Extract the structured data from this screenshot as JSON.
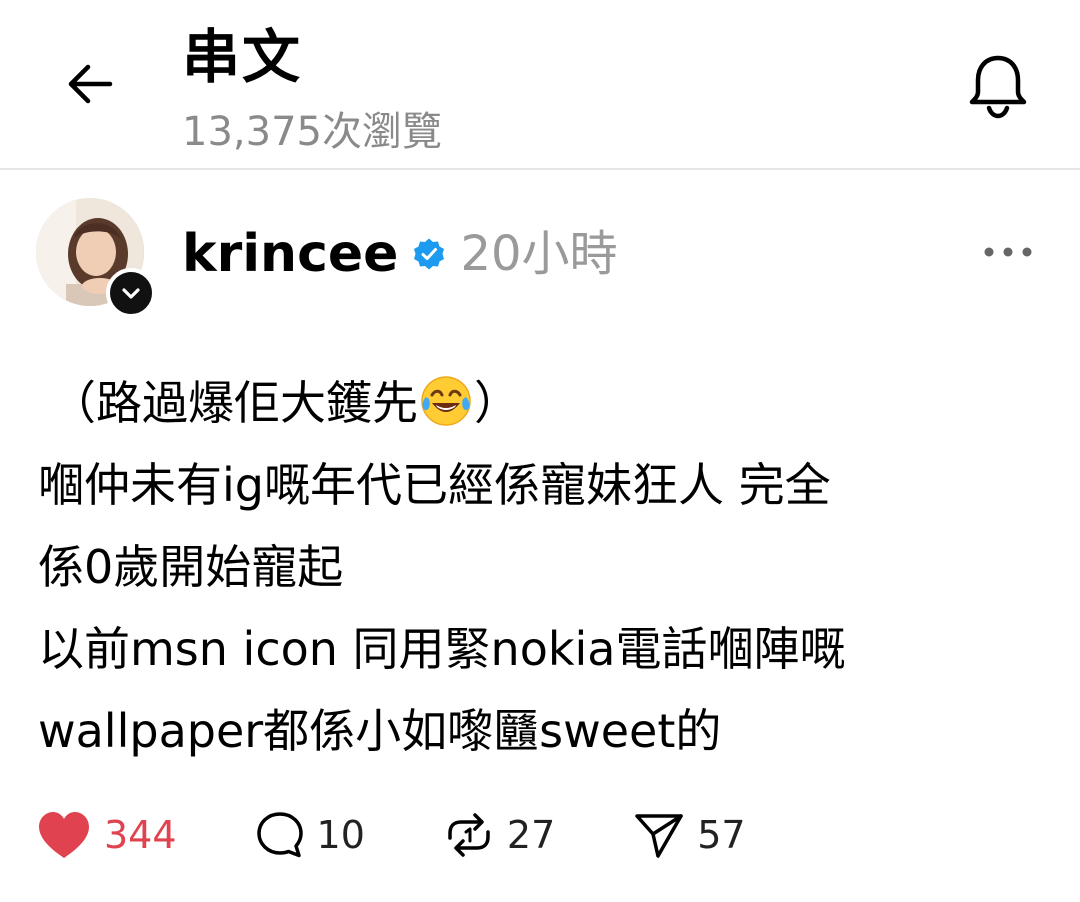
{
  "header": {
    "title": "串文",
    "views": "13,375次瀏覽"
  },
  "post": {
    "username": "krincee",
    "verified": true,
    "time": "20小時",
    "lines": [
      "（路過爆佢大鑊先",
      "嗰仲未有ig嘅年代已經係寵妹狂人 完全",
      "係0歲開始寵起",
      "以前msn icon 同用緊nokia電話嗰陣嘅",
      "wallpaper都係小如嚟㔶sweet的"
    ],
    "line1_close": "）",
    "emoji": "face-with-tears-of-joy",
    "likes": "344",
    "replies": "10",
    "reposts": "27",
    "shares": "57"
  },
  "colors": {
    "like": "#e0424f",
    "verified": "#1d9bf0",
    "muted": "#8a8a8a",
    "divider": "#e6e6e6"
  },
  "icons": {
    "back": "arrow-left-icon",
    "bell": "bell-icon",
    "more": "more-horizontal-icon",
    "like": "heart-icon",
    "reply": "comment-icon",
    "repost": "repost-icon",
    "share": "send-icon"
  }
}
